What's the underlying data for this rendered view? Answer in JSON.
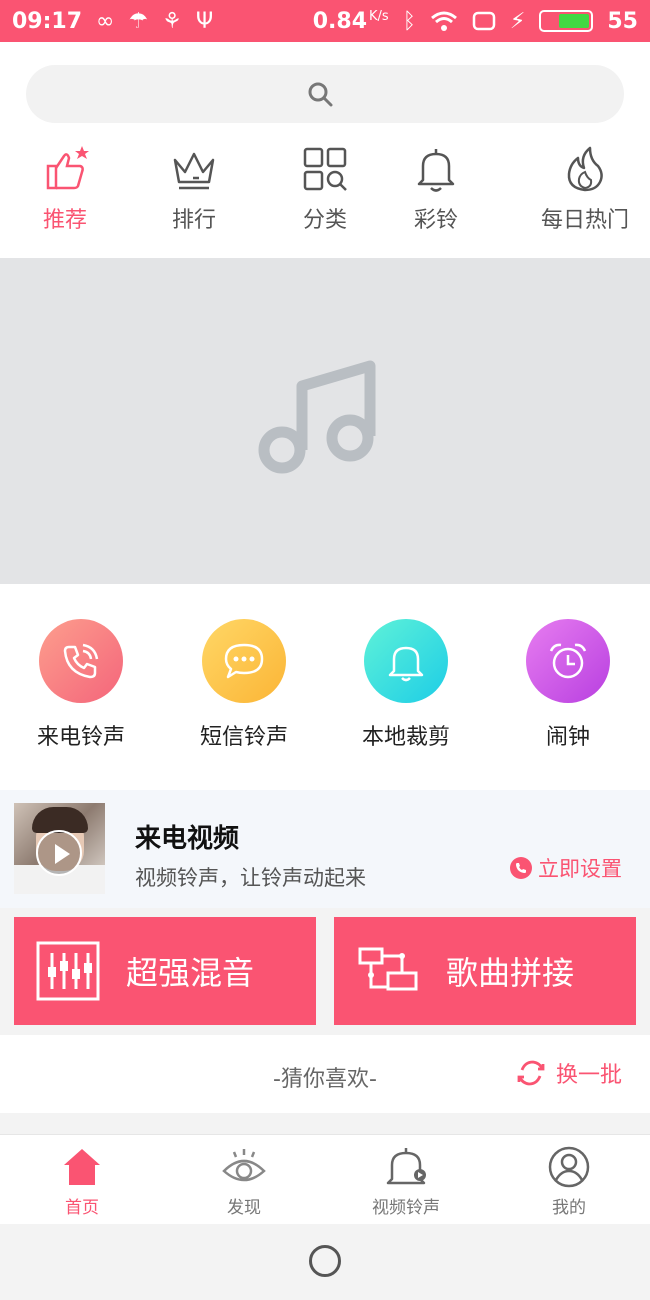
{
  "status_bar": {
    "time": "09:17",
    "speed": "0.84",
    "speed_unit": "K/s",
    "battery": "55"
  },
  "search": {
    "placeholder": ""
  },
  "top_nav": [
    {
      "label": "推荐",
      "icon": "thumbs-up-icon",
      "active": true
    },
    {
      "label": "排行",
      "icon": "crown-icon",
      "active": false
    },
    {
      "label": "分类",
      "icon": "grid-search-icon",
      "active": false
    },
    {
      "label": "彩铃",
      "icon": "bell-icon",
      "active": false
    },
    {
      "label": "每日热门",
      "icon": "flame-icon",
      "active": false
    }
  ],
  "banner": {
    "icon": "music-note-icon"
  },
  "quick_functions": [
    {
      "label": "来电铃声",
      "icon": "phone-ring-icon",
      "color": "#fb7b7b"
    },
    {
      "label": "短信铃声",
      "icon": "message-icon",
      "color": "#fdc84b"
    },
    {
      "label": "本地裁剪",
      "icon": "bell-icon",
      "color": "#3fe0d6"
    },
    {
      "label": "闹钟",
      "icon": "alarm-clock-icon",
      "color": "#d65ae8"
    }
  ],
  "video_promo": {
    "title": "来电视频",
    "subtitle": "视频铃声，让铃声动起来",
    "action": "立即设置"
  },
  "big_buttons": [
    {
      "label": "超强混音",
      "icon": "mixer-icon"
    },
    {
      "label": "歌曲拼接",
      "icon": "splice-icon"
    }
  ],
  "guess": {
    "title": "-猜你喜欢-",
    "refresh": "换一批"
  },
  "bottom_nav": [
    {
      "label": "首页",
      "icon": "home-icon",
      "active": true
    },
    {
      "label": "发现",
      "icon": "eye-icon",
      "active": false
    },
    {
      "label": "视频铃声",
      "icon": "bell-video-icon",
      "active": false
    },
    {
      "label": "我的",
      "icon": "user-icon",
      "active": false
    }
  ],
  "colors": {
    "accent": "#fa5472"
  }
}
